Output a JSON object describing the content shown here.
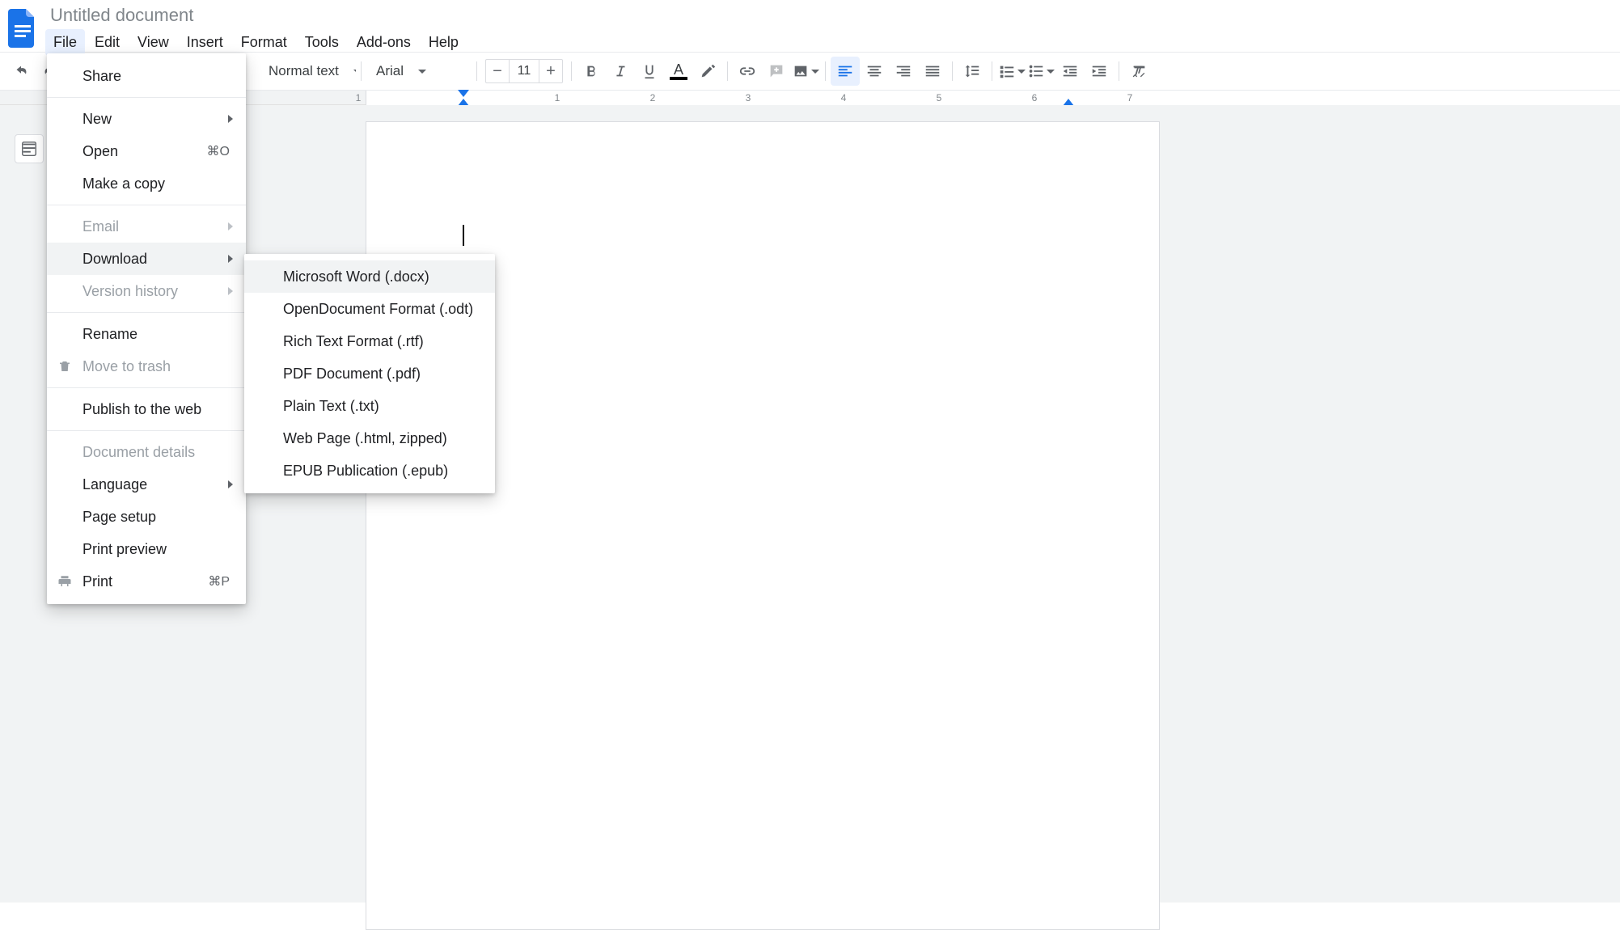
{
  "doc_title": "Untitled document",
  "menu": {
    "items": [
      "File",
      "Edit",
      "View",
      "Insert",
      "Format",
      "Tools",
      "Add-ons",
      "Help"
    ]
  },
  "toolbar": {
    "style_label": "Normal text",
    "font_label": "Arial",
    "font_size": "11"
  },
  "ruler_numbers": [
    "1",
    "1",
    "2",
    "3",
    "4",
    "5",
    "6",
    "7"
  ],
  "file_menu": {
    "share": "Share",
    "new": "New",
    "open": "Open",
    "open_shortcut": "⌘O",
    "make_copy": "Make a copy",
    "email": "Email",
    "download": "Download",
    "version_history": "Version history",
    "rename": "Rename",
    "move_to_trash": "Move to trash",
    "publish": "Publish to the web",
    "doc_details": "Document details",
    "language": "Language",
    "page_setup": "Page setup",
    "print_preview": "Print preview",
    "print": "Print",
    "print_shortcut": "⌘P"
  },
  "download_submenu": [
    "Microsoft Word (.docx)",
    "OpenDocument Format (.odt)",
    "Rich Text Format (.rtf)",
    "PDF Document (.pdf)",
    "Plain Text (.txt)",
    "Web Page (.html, zipped)",
    "EPUB Publication (.epub)"
  ]
}
